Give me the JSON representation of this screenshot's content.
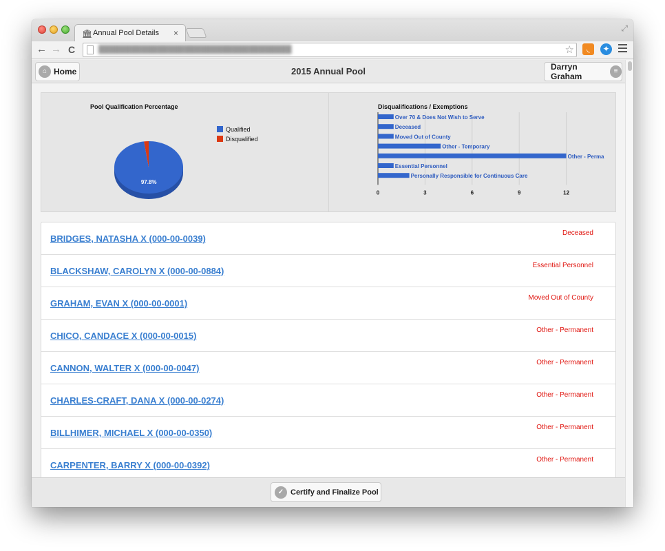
{
  "browser": {
    "tab_title": "Annual Pool Details",
    "tab_close": "×",
    "url": "████████████████████████████████████"
  },
  "header": {
    "home_label": "Home",
    "title": "2015 Annual Pool",
    "user_name": "Darryn Graham"
  },
  "pie_chart": {
    "title": "Pool Qualification Percentage",
    "slice_label": "97.8%",
    "legend": [
      {
        "label": "Qualified",
        "color": "#3366cc"
      },
      {
        "label": "Disqualified",
        "color": "#dc3912"
      }
    ]
  },
  "bar_chart": {
    "title": "Disqualifications / Exemptions"
  },
  "chart_data": [
    {
      "type": "pie",
      "title": "Pool Qualification Percentage",
      "categories": [
        "Qualified",
        "Disqualified"
      ],
      "values": [
        97.8,
        2.2
      ],
      "colors": [
        "#3366cc",
        "#dc3912"
      ],
      "data_labels": [
        "97.8%",
        ""
      ],
      "legend": "right"
    },
    {
      "type": "bar",
      "orientation": "horizontal",
      "title": "Disqualifications / Exemptions",
      "categories": [
        "Over 70 & Does Not Wish to Serve",
        "Deceased",
        "Moved Out of County",
        "Other - Temporary",
        "Other - Perma",
        "Essential Personnel",
        "Personally Responsible for Continuous Care"
      ],
      "values": [
        1,
        1,
        1,
        4,
        12,
        1,
        2
      ],
      "xticks": [
        "0",
        "3",
        "6",
        "9",
        "12"
      ],
      "xlim": [
        0,
        15
      ],
      "color": "#3366cc",
      "grid": true
    }
  ],
  "rows": [
    {
      "name": "BRIDGES, NATASHA X (000-00-0039)",
      "reason": "Deceased"
    },
    {
      "name": "BLACKSHAW, CAROLYN X (000-00-0884)",
      "reason": "Essential Personnel"
    },
    {
      "name": "GRAHAM, EVAN X (000-00-0001)",
      "reason": "Moved Out of County"
    },
    {
      "name": "CHICO, CANDACE X (000-00-0015)",
      "reason": "Other - Permanent"
    },
    {
      "name": "CANNON, WALTER X (000-00-0047)",
      "reason": "Other - Permanent"
    },
    {
      "name": "CHARLES-CRAFT, DANA X (000-00-0274)",
      "reason": "Other - Permanent"
    },
    {
      "name": "BILLHIMER, MICHAEL X (000-00-0350)",
      "reason": "Other - Permanent"
    },
    {
      "name": "CARPENTER, BARRY X (000-00-0392)",
      "reason": "Other - Permanent"
    }
  ],
  "footer": {
    "certify_label": "Certify and Finalize Pool"
  }
}
